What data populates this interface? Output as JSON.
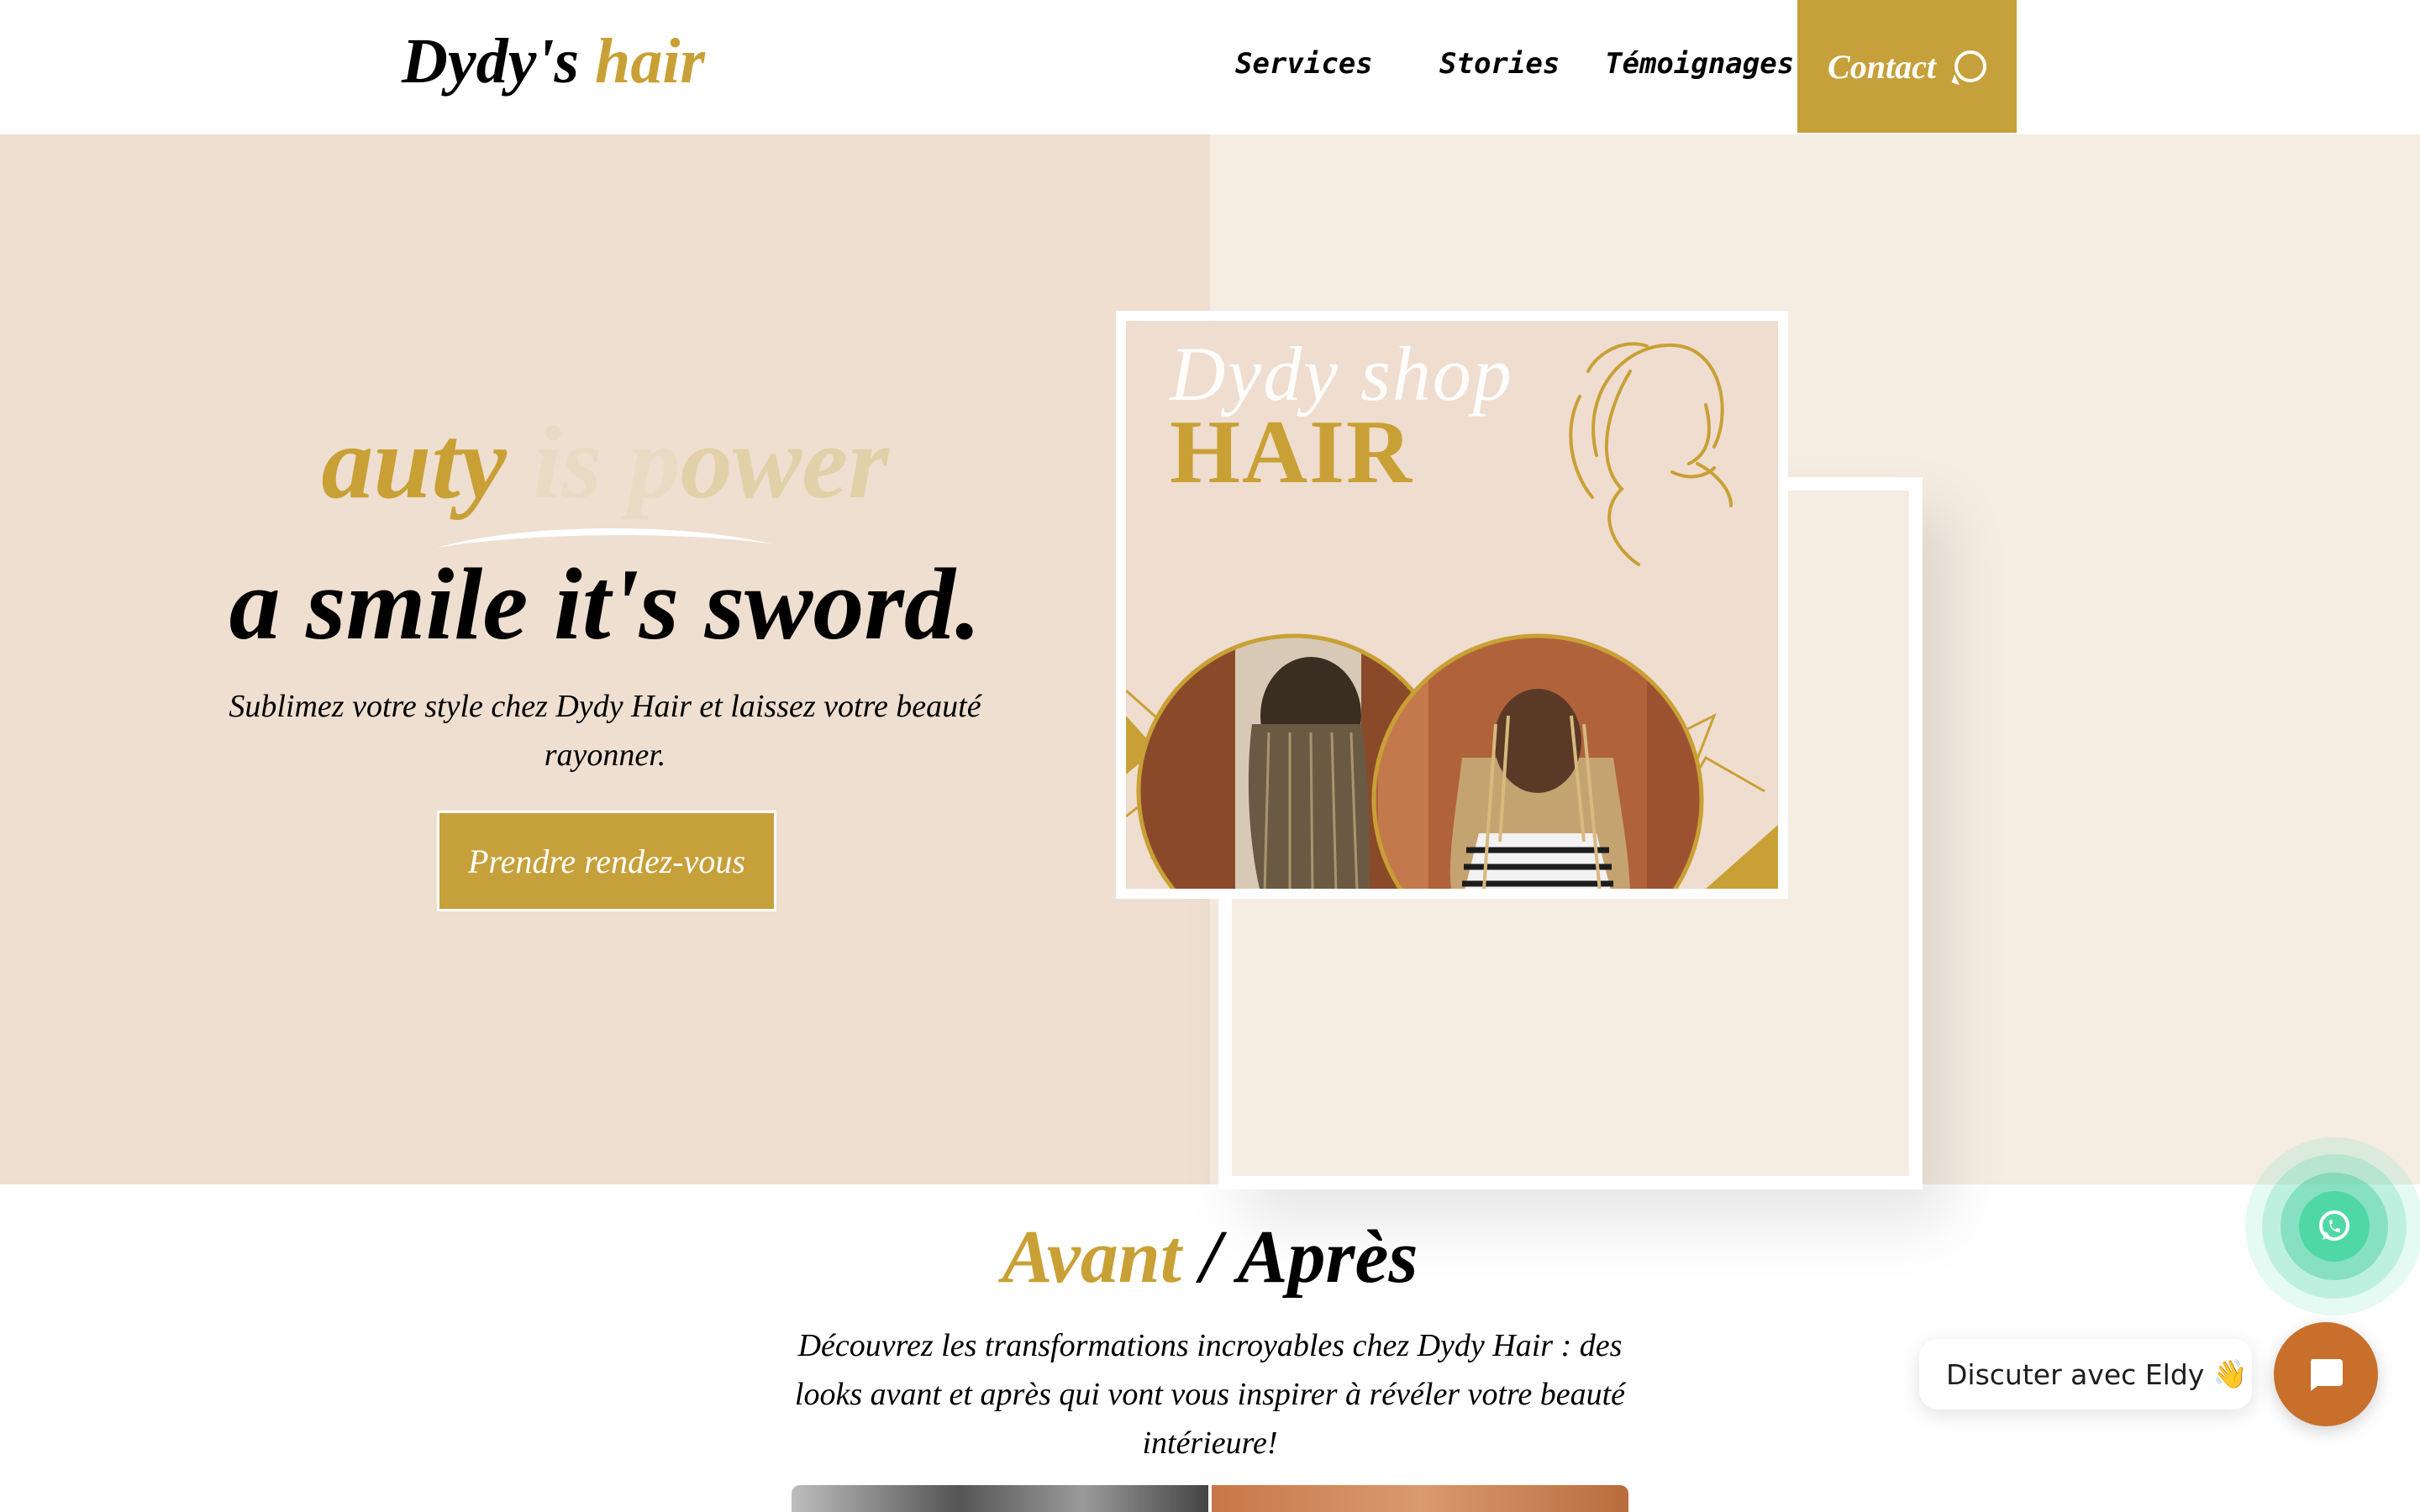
{
  "header": {
    "logo_main": "Dydy's",
    "logo_accent": "hair",
    "nav": [
      "Services",
      "Stories",
      "Témoignages"
    ],
    "contact_label": "Contact"
  },
  "hero": {
    "tagline_part1": "auty ",
    "tagline_part2": "is",
    "tagline_part3": " p",
    "tagline_part4": "ower",
    "headline": "a smile it's sword.",
    "subtitle": "Sublimez votre style chez Dydy Hair et laissez votre beauté rayonner.",
    "cta_label": "Prendre rendez-vous",
    "image_script_text": "Dydy shop",
    "image_title": "HAIR"
  },
  "section": {
    "title_gold": "Avant",
    "title_separator": " / ",
    "title_black": "Après",
    "description": "Découvrez les transformations incroyables chez Dydy Hair : des looks avant et après qui vont vous inspirer à révéler votre beauté intérieure!"
  },
  "widgets": {
    "chat_label": "Discuter avec Eldy",
    "chat_emoji": "👋"
  },
  "colors": {
    "gold": "#C6A03A",
    "hero_left_bg": "#EEDFD1",
    "hero_right_bg": "#F5ECE2",
    "whatsapp_green": "#4FD8A6",
    "chat_orange": "#C86F2B"
  },
  "icons": [
    "whatsapp-icon",
    "chat-icon",
    "woman-face-line-art-icon"
  ]
}
